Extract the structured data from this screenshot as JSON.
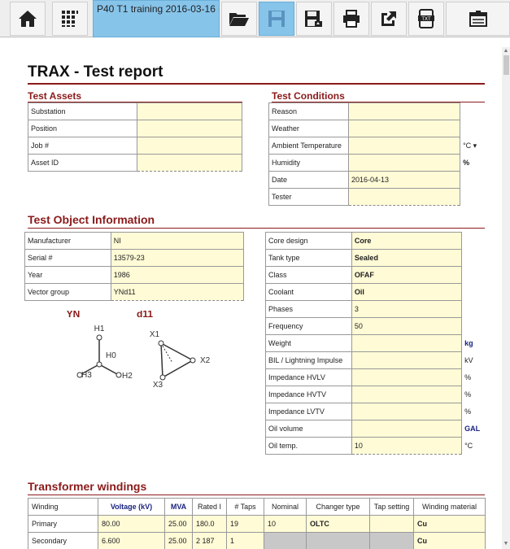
{
  "toolbar": {
    "title": "P40 T1 training 2016-03-16 -",
    "icons": [
      "home-icon",
      "grid-icon",
      "open-folder-icon",
      "save-icon",
      "save-as-icon",
      "print-icon",
      "export-icon",
      "txt-export-icon",
      "settings-icon"
    ]
  },
  "report": {
    "title": "TRAX - Test report"
  },
  "test_assets": {
    "heading": "Test Assets",
    "rows": [
      {
        "label": "Substation",
        "value": ""
      },
      {
        "label": "Position",
        "value": ""
      },
      {
        "label": "Job #",
        "value": ""
      },
      {
        "label": "Asset ID",
        "value": ""
      }
    ]
  },
  "test_conditions": {
    "heading": "Test Conditions",
    "rows": [
      {
        "label": "Reason",
        "value": "",
        "unit": ""
      },
      {
        "label": "Weather",
        "value": "",
        "unit": ""
      },
      {
        "label": "Ambient Temperature",
        "value": "",
        "unit": "°C ▾"
      },
      {
        "label": "Humidity",
        "value": "",
        "unit": "%"
      },
      {
        "label": "Date",
        "value": "2016-04-13",
        "unit": ""
      },
      {
        "label": "Tester",
        "value": "",
        "unit": ""
      }
    ]
  },
  "test_object": {
    "heading": "Test Object Information",
    "left_rows": [
      {
        "label": "Manufacturer",
        "value": "NI"
      },
      {
        "label": "Serial #",
        "value": "13579-23"
      },
      {
        "label": "Year",
        "value": "1986"
      },
      {
        "label": "Vector group",
        "value": "YNd11"
      }
    ],
    "right_rows": [
      {
        "label": "Core design",
        "value": "Core",
        "unit": ""
      },
      {
        "label": "Tank type",
        "value": "Sealed",
        "unit": ""
      },
      {
        "label": "Class",
        "value": "OFAF",
        "unit": ""
      },
      {
        "label": "Coolant",
        "value": "Oil",
        "unit": ""
      },
      {
        "label": "Phases",
        "value": "3",
        "unit": ""
      },
      {
        "label": "Frequency",
        "value": "50",
        "unit": ""
      },
      {
        "label": "Weight",
        "value": "",
        "unit": "kg"
      },
      {
        "label": "BIL / Lightning Impulse",
        "value": "",
        "unit": "kV"
      },
      {
        "label": "Impedance HVLV",
        "value": "",
        "unit": "%"
      },
      {
        "label": "Impedance HVTV",
        "value": "",
        "unit": "%"
      },
      {
        "label": "Impedance LVTV",
        "value": "",
        "unit": "%"
      },
      {
        "label": "Oil volume",
        "value": "",
        "unit": "GAL"
      },
      {
        "label": "Oil temp.",
        "value": "10",
        "unit": "°C"
      }
    ],
    "diagram": {
      "yn_label": "YN",
      "d11_label": "d11",
      "h1": "H1",
      "h0": "H0",
      "h2": "H2",
      "h3": "H3",
      "x1": "X1",
      "x2": "X2",
      "x3": "X3"
    }
  },
  "windings": {
    "heading": "Transformer windings",
    "headers": [
      "Winding",
      "Voltage (kV)",
      "MVA",
      "Rated I",
      "# Taps",
      "Nominal",
      "Changer type",
      "Tap setting",
      "Winding material"
    ],
    "rows": [
      {
        "winding": "Primary",
        "voltage": "80.00",
        "mva": "25.00",
        "rated_i": "180.0",
        "taps": "19",
        "nominal": "10",
        "changer": "OLTC",
        "tap_setting": "",
        "material": "Cu"
      },
      {
        "winding": "Secondary",
        "voltage": "6.600",
        "mva": "25.00",
        "rated_i": "2 187",
        "taps": "1",
        "nominal": "",
        "changer": "",
        "tap_setting": "",
        "material": "Cu"
      }
    ]
  },
  "colors": {
    "accent": "#8b1a1a",
    "field_bg": "#fffbd6",
    "title_bg": "#87c4ea",
    "unit_blue": "#1a237e"
  }
}
